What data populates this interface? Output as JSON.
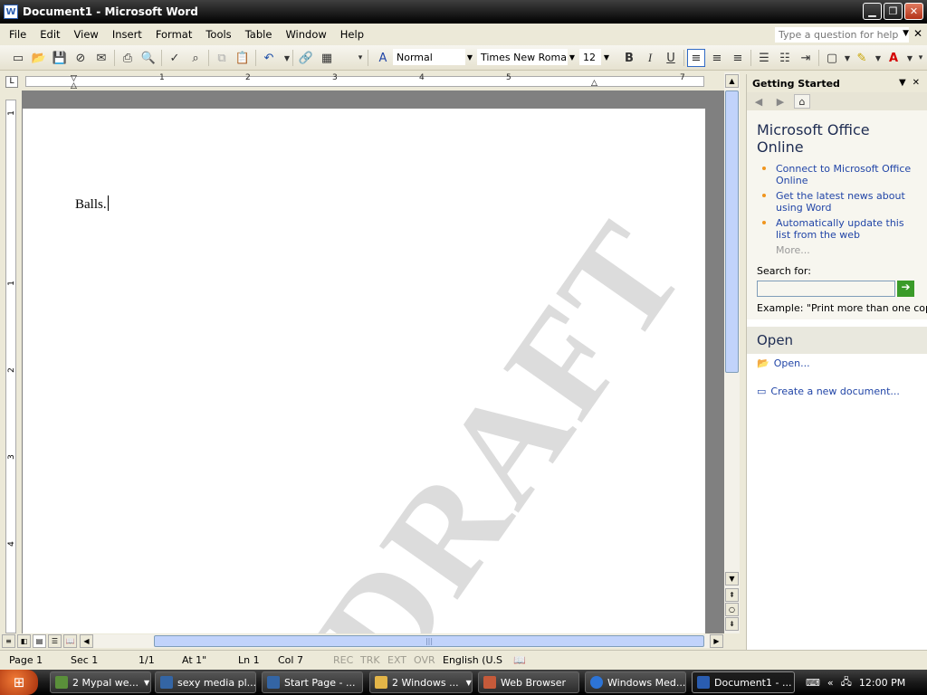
{
  "window": {
    "title": "Document1 - Microsoft Word",
    "app_icon": "W"
  },
  "window_controls": {
    "minimize": "▁",
    "restore": "❐",
    "close": "✕"
  },
  "menu": [
    "File",
    "Edit",
    "View",
    "Insert",
    "Format",
    "Tools",
    "Table",
    "Window",
    "Help"
  ],
  "help": {
    "placeholder": "Type a question for help"
  },
  "formatting": {
    "style": "Normal",
    "font": "Times New Roman",
    "size": "12",
    "bold": "B",
    "italic": "I",
    "underline": "U",
    "font_color_glyph": "A"
  },
  "ruler": {
    "h_numbers": [
      "1",
      "2",
      "3",
      "4",
      "5",
      "7"
    ],
    "v_numbers": [
      "1",
      "1",
      "2",
      "3",
      "4"
    ],
    "tab_marker": "L"
  },
  "document": {
    "text": "Balls.",
    "watermark": "DRAFT"
  },
  "task_pane": {
    "title": "Getting Started",
    "section_title": "Microsoft Office Online",
    "links": [
      "Connect to Microsoft Office Online",
      "Get the latest news about using Word",
      "Automatically update this list from the web"
    ],
    "more": "More...",
    "search_label": "Search for:",
    "search_value": "",
    "example": "Example:  \"Print more than one copy\"",
    "open_title": "Open",
    "open_link": "Open...",
    "new_link": "Create a new document..."
  },
  "status": {
    "page": "Page  1",
    "sec": "Sec  1",
    "pages": "1/1",
    "at": "At  1\"",
    "ln": "Ln  1",
    "col": "Col  7",
    "rec": "REC",
    "trk": "TRK",
    "ext": "EXT",
    "ovr": "OVR",
    "language": "English (U.S"
  },
  "taskbar": {
    "items": [
      {
        "label": "2 Mypal we...",
        "icon_color": "#5a8f3a"
      },
      {
        "label": "sexy media pl...",
        "icon_color": "#3465a4"
      },
      {
        "label": "Start Page - ...",
        "icon_color": "#3465a4"
      },
      {
        "label": "2 Windows ...",
        "icon_color": "#e3b548"
      },
      {
        "label": "Web Browser",
        "icon_color": "#c55a3a"
      },
      {
        "label": "Windows Med...",
        "icon_color": "#2d74d6"
      },
      {
        "label": "Document1 - ...",
        "icon_color": "#2a5db0"
      }
    ],
    "clock": "12:00 PM"
  }
}
